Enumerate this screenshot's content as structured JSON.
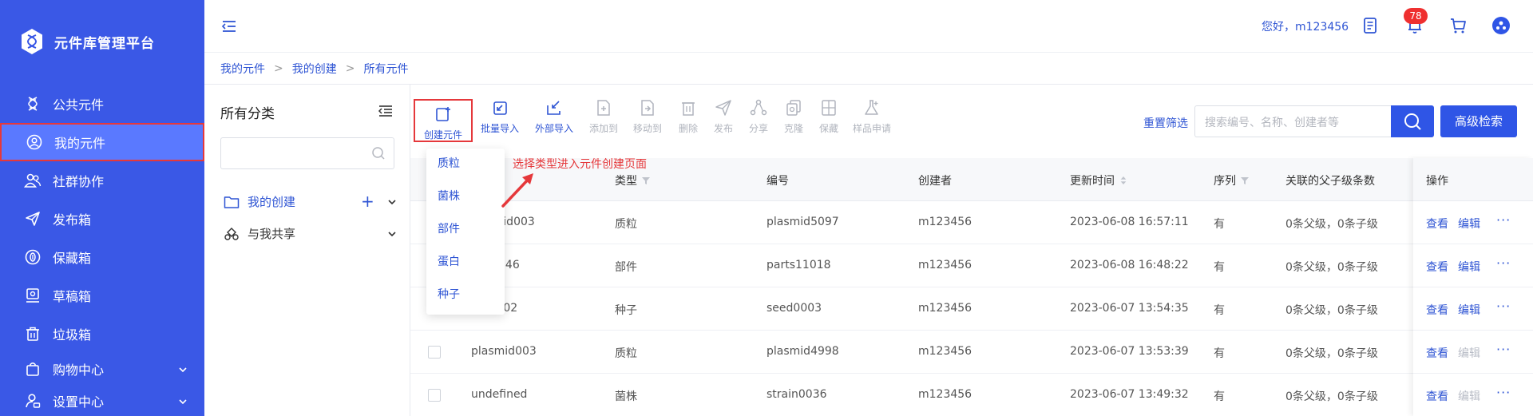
{
  "app": {
    "title": "元件库管理平台"
  },
  "sidebar": {
    "items": [
      {
        "label": "公共元件",
        "icon": "dna-icon"
      },
      {
        "label": "我的元件",
        "icon": "user-circle-icon",
        "active": true
      },
      {
        "label": "社群协作",
        "icon": "users-icon"
      },
      {
        "label": "发布箱",
        "icon": "send-icon"
      },
      {
        "label": "保藏箱",
        "icon": "vault-icon"
      },
      {
        "label": "草稿箱",
        "icon": "draft-icon"
      },
      {
        "label": "垃圾箱",
        "icon": "trash-icon"
      },
      {
        "label": "购物中心",
        "icon": "shop-icon",
        "expandable": true
      },
      {
        "label": "设置中心",
        "icon": "user-settings-icon",
        "expandable": true
      }
    ]
  },
  "header": {
    "greeting": "您好，m123456",
    "notification_count": "78"
  },
  "breadcrumb": [
    "我的元件",
    "我的创建",
    "所有元件"
  ],
  "category": {
    "title": "所有分类",
    "search_placeholder": "",
    "tree": [
      {
        "label": "我的创建",
        "active": true
      },
      {
        "label": "与我共享",
        "active": false
      }
    ]
  },
  "toolbar": {
    "tools": [
      {
        "label": "创建元件",
        "icon": "create-icon",
        "enabled": true
      },
      {
        "label": "批量导入",
        "icon": "batch-import-icon",
        "enabled": true
      },
      {
        "label": "外部导入",
        "icon": "external-import-icon",
        "enabled": true
      },
      {
        "label": "添加到",
        "icon": "add-to-icon",
        "enabled": false
      },
      {
        "label": "移动到",
        "icon": "move-to-icon",
        "enabled": false
      },
      {
        "label": "删除",
        "icon": "delete-icon",
        "enabled": false
      },
      {
        "label": "发布",
        "icon": "publish-icon",
        "enabled": false
      },
      {
        "label": "分享",
        "icon": "share-icon",
        "enabled": false
      },
      {
        "label": "克隆",
        "icon": "clone-icon",
        "enabled": false
      },
      {
        "label": "保藏",
        "icon": "store-icon",
        "enabled": false
      },
      {
        "label": "样品申请",
        "icon": "sample-request-icon",
        "enabled": false
      }
    ],
    "reset_label": "重置筛选",
    "search_placeholder": "搜索编号、名称、创建者等",
    "advanced_label": "高级检索"
  },
  "dropdown": {
    "items": [
      "质粒",
      "菌株",
      "部件",
      "蛋白",
      "种子"
    ]
  },
  "annotation": "选择类型进入元件创建页面",
  "table": {
    "columns": {
      "type": "类型",
      "code": "编号",
      "creator": "创建者",
      "updated": "更新时间",
      "sequence": "序列",
      "relations": "关联的父子级条数",
      "ops": "操作"
    },
    "rows": [
      {
        "name": "plasmid003",
        "type": "质粒",
        "code": "plasmid5097",
        "creator": "m123456",
        "updated": "2023-06-08 16:57:11",
        "sequence": "有",
        "relations": "0条父级，0条子级",
        "view": "查看",
        "edit": "编辑",
        "edit_enabled": true
      },
      {
        "name": "parts346",
        "type": "部件",
        "code": "parts11018",
        "creator": "m123456",
        "updated": "2023-06-08 16:48:22",
        "sequence": "有",
        "relations": "0条父级，0条子级",
        "view": "查看",
        "edit": "编辑",
        "edit_enabled": true
      },
      {
        "name": "seed002",
        "type": "种子",
        "code": "seed0003",
        "creator": "m123456",
        "updated": "2023-06-07 13:54:35",
        "sequence": "有",
        "relations": "0条父级，0条子级",
        "view": "查看",
        "edit": "编辑",
        "edit_enabled": true
      },
      {
        "name": "plasmid003",
        "type": "质粒",
        "code": "plasmid4998",
        "creator": "m123456",
        "updated": "2023-06-07 13:53:39",
        "sequence": "有",
        "relations": "0条父级，0条子级",
        "view": "查看",
        "edit": "编辑",
        "edit_enabled": false
      },
      {
        "name": "undefined",
        "type": "菌株",
        "code": "strain0036",
        "creator": "m123456",
        "updated": "2023-06-07 13:49:32",
        "sequence": "有",
        "relations": "0条父级，0条子级",
        "view": "查看",
        "edit": "编辑",
        "edit_enabled": false
      }
    ],
    "more_label": "···"
  },
  "colors": {
    "sidebar_bg": "#3a58e6",
    "active_item_bg": "#5a79ff",
    "primary": "#2f55e6",
    "highlight": "#e5383b"
  }
}
